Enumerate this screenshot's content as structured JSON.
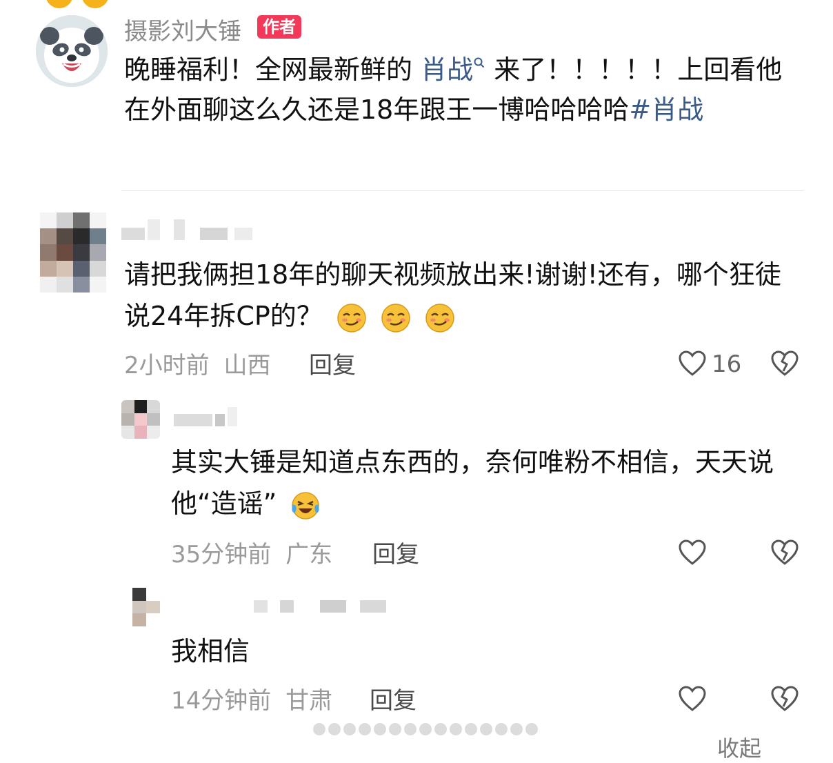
{
  "post": {
    "author": "摄影刘大锤",
    "author_badge": "作者",
    "text_before_link": "晚睡福利！全网最新鲜的 ",
    "link_text": "肖战",
    "text_after_link": " 来了！！！！！上回看他在外面聊这么久还是18年跟王一博哈哈哈哈",
    "hashtag": "#肖战"
  },
  "comments": [
    {
      "text": "请把我俩担18年的聊天视频放出来!谢谢!还有，哪个狂徒说24年拆CP的？",
      "emoji_count": 3,
      "time": "2小时前",
      "location": "山西",
      "reply_label": "回复",
      "like_count": "16"
    },
    {
      "text": "其实大锤是知道点东西的，奈何唯粉不相信，天天说他“造谣”",
      "time": "35分钟前",
      "location": "广东",
      "reply_label": "回复"
    },
    {
      "text": "我相信",
      "time": "14分钟前",
      "location": "甘肃",
      "reply_label": "回复"
    }
  ],
  "footer": {
    "collapse_label": "收起"
  },
  "icons": [
    "heart-icon",
    "broken-heart-icon",
    "search-icon",
    "smirk-emoji-icon",
    "laugh-cry-emoji-icon"
  ]
}
